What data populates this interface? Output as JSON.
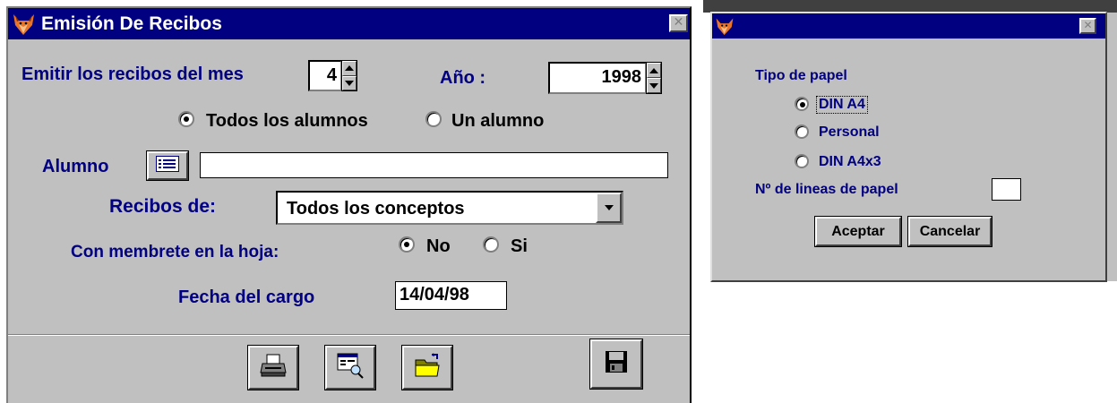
{
  "main_window": {
    "title": "Emisión De Recibos",
    "close_glyph": "✕",
    "month_label": "Emitir los recibos del mes",
    "month_value": "4",
    "year_label": "Año :",
    "year_value": "1998",
    "scope_options": [
      {
        "label": "Todos los alumnos",
        "checked": true
      },
      {
        "label": "Un alumno",
        "checked": false
      }
    ],
    "student_label": "Alumno",
    "student_value": "",
    "receipts_label": "Recibos de:",
    "receipts_value": "Todos los conceptos",
    "letterhead_label": "Con membrete en la hoja:",
    "letterhead_options": [
      {
        "label": "No",
        "checked": true
      },
      {
        "label": "Si",
        "checked": false
      }
    ],
    "charge_date_label": "Fecha del cargo",
    "charge_date_value": "14/04/98",
    "toolbar": {
      "icons": [
        "printer-icon",
        "print-preview-icon",
        "open-folder-icon",
        "save-disk-icon"
      ]
    }
  },
  "print_dialog": {
    "title": "",
    "close_glyph": "✕",
    "paper_type_label": "Tipo de papel",
    "paper_options": [
      {
        "label": "DIN A4",
        "checked": true
      },
      {
        "label": "Personal",
        "checked": false
      },
      {
        "label": "DIN A4x3",
        "checked": false
      }
    ],
    "lines_label": "Nº de lineas de papel",
    "lines_value": "",
    "accept_label": "Aceptar",
    "cancel_label": "Cancelar"
  },
  "colors": {
    "titlebar": "#000080",
    "window_bg": "#c0c0c0",
    "label_text": "#000080"
  }
}
